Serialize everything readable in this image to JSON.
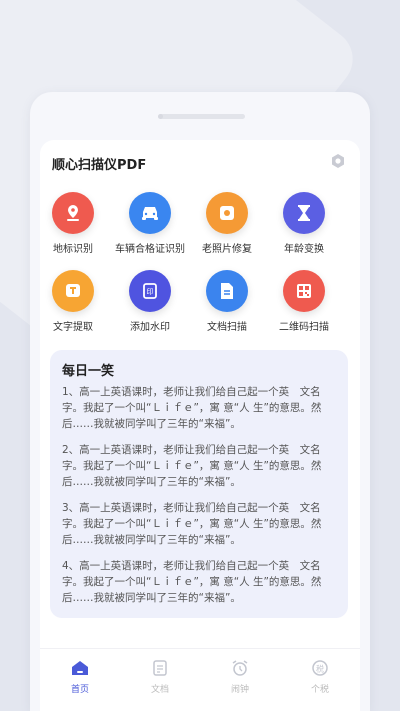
{
  "app": {
    "title": "顺心扫描仪PDF"
  },
  "features": [
    {
      "label": "地标识别",
      "icon": "landmark-icon",
      "color": "#ef5a4f"
    },
    {
      "label": "车辆合格证识别",
      "icon": "car-icon",
      "color": "#3a86f0"
    },
    {
      "label": "老照片修复",
      "icon": "photo-icon",
      "color": "#f59a35"
    },
    {
      "label": "年龄变换",
      "icon": "hourglass-icon",
      "color": "#5b5fe3"
    },
    {
      "label": "文字提取",
      "icon": "text-icon",
      "color": "#f7a533"
    },
    {
      "label": "添加水印",
      "icon": "watermark-icon",
      "color": "#4f54e0"
    },
    {
      "label": "文档扫描",
      "icon": "document-icon",
      "color": "#3b84ee"
    },
    {
      "label": "二维码扫描",
      "icon": "qrcode-icon",
      "color": "#ef5a4f"
    }
  ],
  "joke_section": {
    "title": "每日一笑",
    "items": [
      "1、高一上英语课时，老师让我们给自己起一个英　文名 字。我起了一个叫“Ｌｉｆｅ”，寓 意“人 生”的意思。然后……我就被同学叫了三年的“来福”。",
      "2、高一上英语课时，老师让我们给自己起一个英　文名 字。我起了一个叫“Ｌｉｆｅ”，寓 意“人 生”的意思。然后……我就被同学叫了三年的“来福”。",
      "3、高一上英语课时，老师让我们给自己起一个英　文名 字。我起了一个叫“Ｌｉｆｅ”，寓 意“人 生”的意思。然后……我就被同学叫了三年的“来福”。",
      "4、高一上英语课时，老师让我们给自己起一个英　文名 字。我起了一个叫“Ｌｉｆｅ”，寓 意“人 生”的意思。然后……我就被同学叫了三年的“来福”。"
    ]
  },
  "tabs": [
    {
      "label": "首页",
      "icon": "home-icon",
      "active": true
    },
    {
      "label": "文档",
      "icon": "docs-icon",
      "active": false
    },
    {
      "label": "闹钟",
      "icon": "alarm-icon",
      "active": false
    },
    {
      "label": "个税",
      "icon": "tax-icon",
      "active": false
    }
  ],
  "colors": {
    "accent": "#4a5ad8",
    "joke_bg": "#eef0fb"
  }
}
